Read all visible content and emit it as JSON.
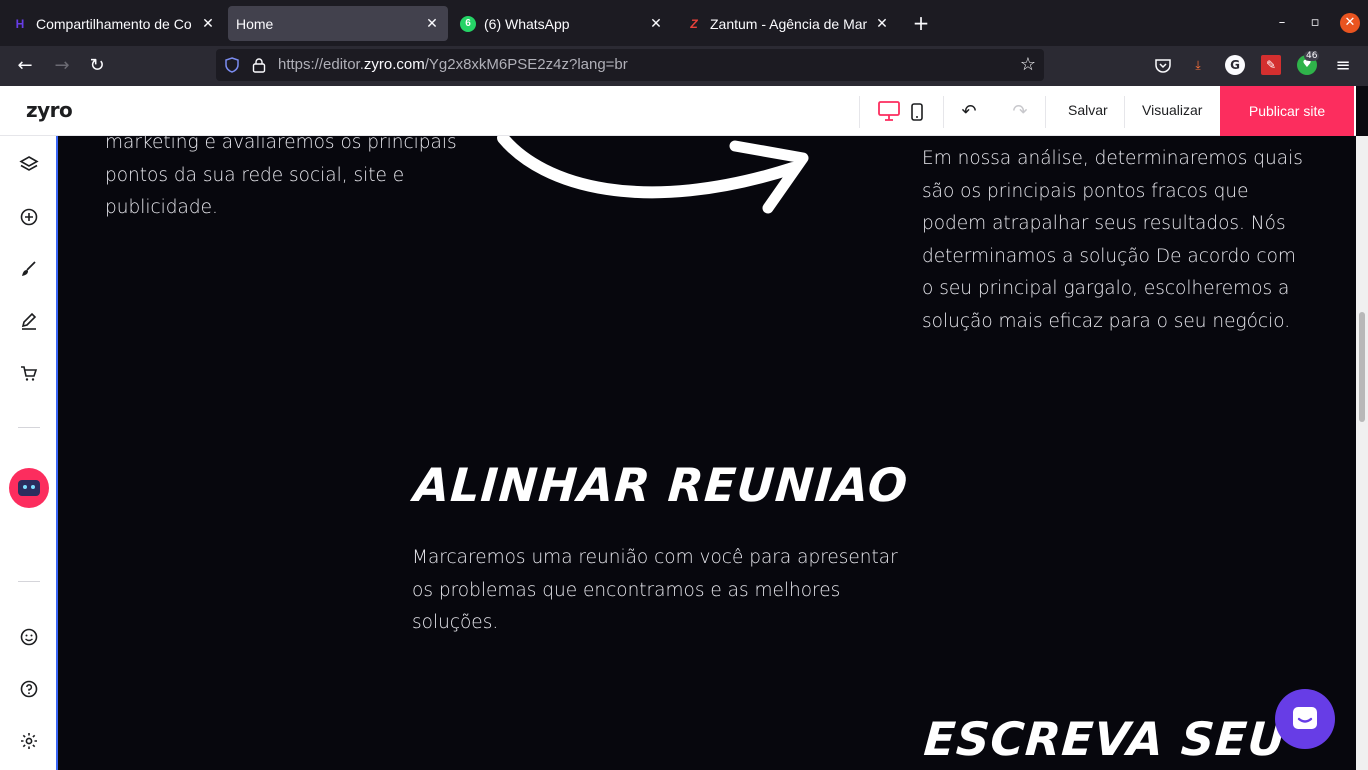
{
  "browser": {
    "tabs": [
      {
        "title": "Compartilhamento de Co",
        "icon": "hostinger-icon",
        "icon_color": "#673de6"
      },
      {
        "title": "Home",
        "icon": "none",
        "active": true
      },
      {
        "title": "(6) WhatsApp",
        "icon": "whatsapp-icon",
        "badge": "6",
        "icon_color": "#25d366"
      },
      {
        "title": "Zantum - Agência de Mar",
        "icon": "zantum-icon",
        "icon_color": "#e8423a"
      }
    ],
    "url": {
      "prefix": "https://editor.",
      "domain": "zyro.com",
      "path": "/Yg2x8xkM6PSE2z4z?lang=br"
    },
    "ext_badge": "46"
  },
  "editor": {
    "logo": "zyro",
    "save_label": "Salvar",
    "preview_label": "Visualizar",
    "publish_label": "Publicar site",
    "accent": "#fc2d5e"
  },
  "content": {
    "left_text": [
      "marketing e avaliaremos os principais",
      "pontos da sua rede social, site e",
      "publicidade."
    ],
    "right_text": [
      "Em nossa análise, determinaremos quais",
      "são os principais pontos fracos que",
      "podem atrapalhar seus resultados. Nós",
      "determinamos a solução De acordo com",
      "o seu principal gargalo, escolheremos a",
      "solução mais eficaz para o seu negócio."
    ],
    "heading_1": "ALINHAR REUNIAO",
    "middle_text": [
      "Marcaremos uma reunião com você para apresentar",
      "os problemas que encontramos e as melhores",
      "soluções."
    ],
    "heading_2": "ESCREVA SEU"
  }
}
